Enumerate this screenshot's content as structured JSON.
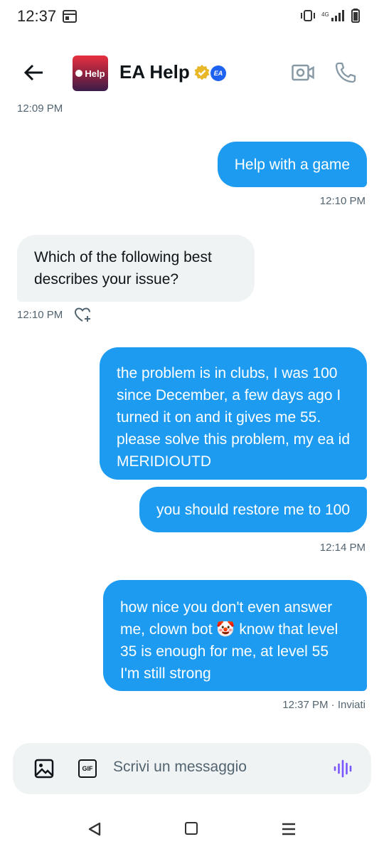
{
  "status_bar": {
    "time": "12:37",
    "network": "4G"
  },
  "header": {
    "contact_name": "EA Help",
    "avatar_text": "Help",
    "ea_badge": "EA"
  },
  "messages": [
    {
      "kind": "timestamp",
      "text": "12:09 PM"
    },
    {
      "kind": "out",
      "text": "Help with a game"
    },
    {
      "kind": "timestamp",
      "text": "12:10 PM"
    },
    {
      "kind": "in",
      "text": "Which of the following best describes your issue?"
    },
    {
      "kind": "timestamp",
      "text": "12:10 PM"
    },
    {
      "kind": "out",
      "text": "the problem is in clubs, I was 100 since December, a few days ago I turned it on and it gives me 55. please solve this problem, my ea id MERIDIOUTD"
    },
    {
      "kind": "out",
      "text": "you should restore me to 100"
    },
    {
      "kind": "timestamp",
      "text": "12:14 PM"
    },
    {
      "kind": "out",
      "text": "how nice you don't even answer me, clown bot 🤡 know that level 35 is enough for me, at level 55 I'm still strong"
    },
    {
      "kind": "timestamp",
      "text": "12:37 PM · Inviati"
    }
  ],
  "composer": {
    "gif_label": "GIF",
    "placeholder": "Scrivi un messaggio"
  },
  "colors": {
    "accent": "#1d9bf0",
    "incoming_bubble": "#eff3f4",
    "verified_gold": "#e8b829",
    "voice_purple": "#7856ff"
  }
}
